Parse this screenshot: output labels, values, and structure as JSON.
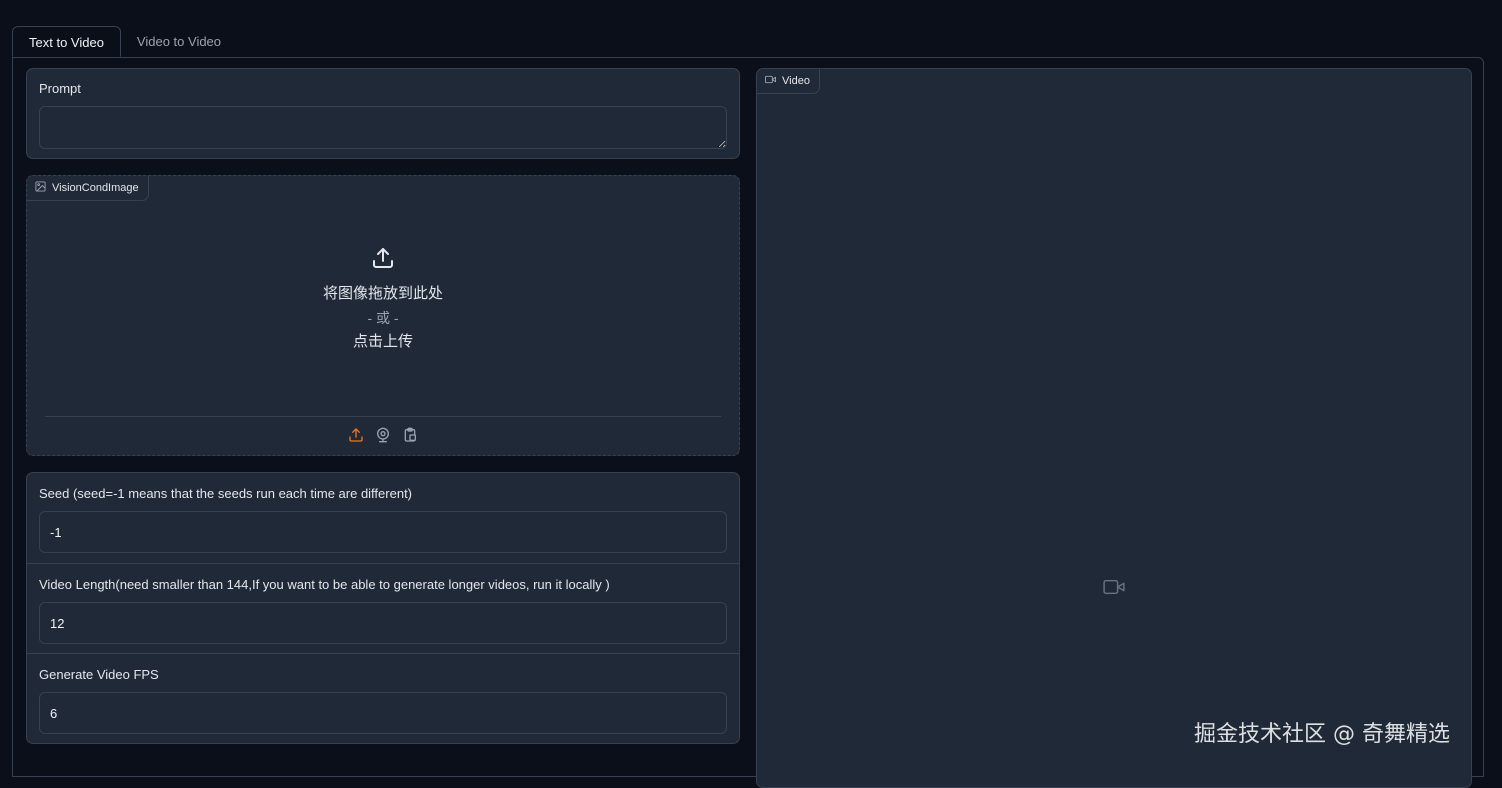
{
  "tabs": [
    "Text to Video",
    "Video to Video"
  ],
  "prompt": {
    "label": "Prompt",
    "value": ""
  },
  "vision_image": {
    "chip_label": "VisionCondImage",
    "drop_text": "将图像拖放到此处",
    "or_text": "- 或 -",
    "click_text": "点击上传"
  },
  "seed": {
    "label": "Seed (seed=-1 means that the seeds run each time are different)",
    "value": "-1"
  },
  "video_length": {
    "label": "Video Length(need smaller than 144,If you want to be able to generate longer videos, run it locally )",
    "value": "12"
  },
  "fps": {
    "label": "Generate Video FPS",
    "value": "6"
  },
  "video": {
    "chip_label": "Video"
  },
  "watermark": "掘金技术社区 @ 奇舞精选",
  "colors": {
    "background": "#0b0f19",
    "panel": "#1f2937",
    "border": "#374151",
    "accent": "#f97316"
  }
}
